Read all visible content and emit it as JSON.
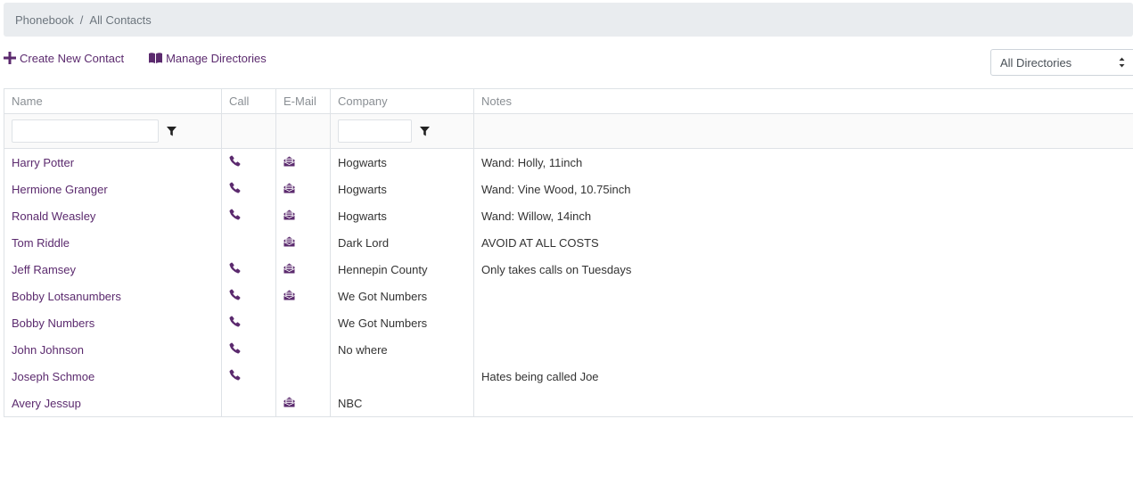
{
  "breadcrumb": {
    "root": "Phonebook",
    "separator": "/",
    "current": "All Contacts"
  },
  "actions": {
    "create_label": "Create New Contact",
    "manage_label": "Manage Directories"
  },
  "directory_select": {
    "selected": "All Directories"
  },
  "colors": {
    "accent": "#5b2a6e",
    "breadcrumb_bg": "#e9ecef",
    "border": "#dee2e6"
  },
  "table": {
    "headers": {
      "name": "Name",
      "call": "Call",
      "email": "E-Mail",
      "company": "Company",
      "notes": "Notes"
    },
    "rows": [
      {
        "name": "Harry Potter",
        "call": "phone-icon",
        "email": "envelope-open-icon",
        "company": "Hogwarts",
        "notes": "Wand: Holly, 11inch"
      },
      {
        "name": "Hermione Granger",
        "call": "phone-icon",
        "email": "envelope-open-icon",
        "company": "Hogwarts",
        "notes": "Wand: Vine Wood, 10.75inch"
      },
      {
        "name": "Ronald Weasley",
        "call": "phone-icon",
        "email": "envelope-open-icon",
        "company": "Hogwarts",
        "notes": "Wand: Willow, 14inch"
      },
      {
        "name": "Tom Riddle",
        "call": "",
        "email": "envelope-open-icon",
        "company": "Dark Lord",
        "notes": "AVOID AT ALL COSTS"
      },
      {
        "name": "Jeff Ramsey",
        "call": "phone-icon",
        "email": "envelope-open-icon",
        "company": "Hennepin County",
        "notes": "Only takes calls on Tuesdays"
      },
      {
        "name": "Bobby Lotsanumbers",
        "call": "phone-icon",
        "email": "envelope-open-icon",
        "company": "We Got Numbers",
        "notes": ""
      },
      {
        "name": "Bobby Numbers",
        "call": "phone-icon",
        "email": "",
        "company": "We Got Numbers",
        "notes": ""
      },
      {
        "name": "John Johnson",
        "call": "phone-icon",
        "email": "",
        "company": "No where",
        "notes": ""
      },
      {
        "name": "Joseph Schmoe",
        "call": "phone-icon",
        "email": "",
        "company": "",
        "notes": "Hates being called Joe"
      },
      {
        "name": "Avery Jessup",
        "call": "",
        "email": "envelope-open-icon",
        "company": "NBC",
        "notes": ""
      }
    ]
  }
}
